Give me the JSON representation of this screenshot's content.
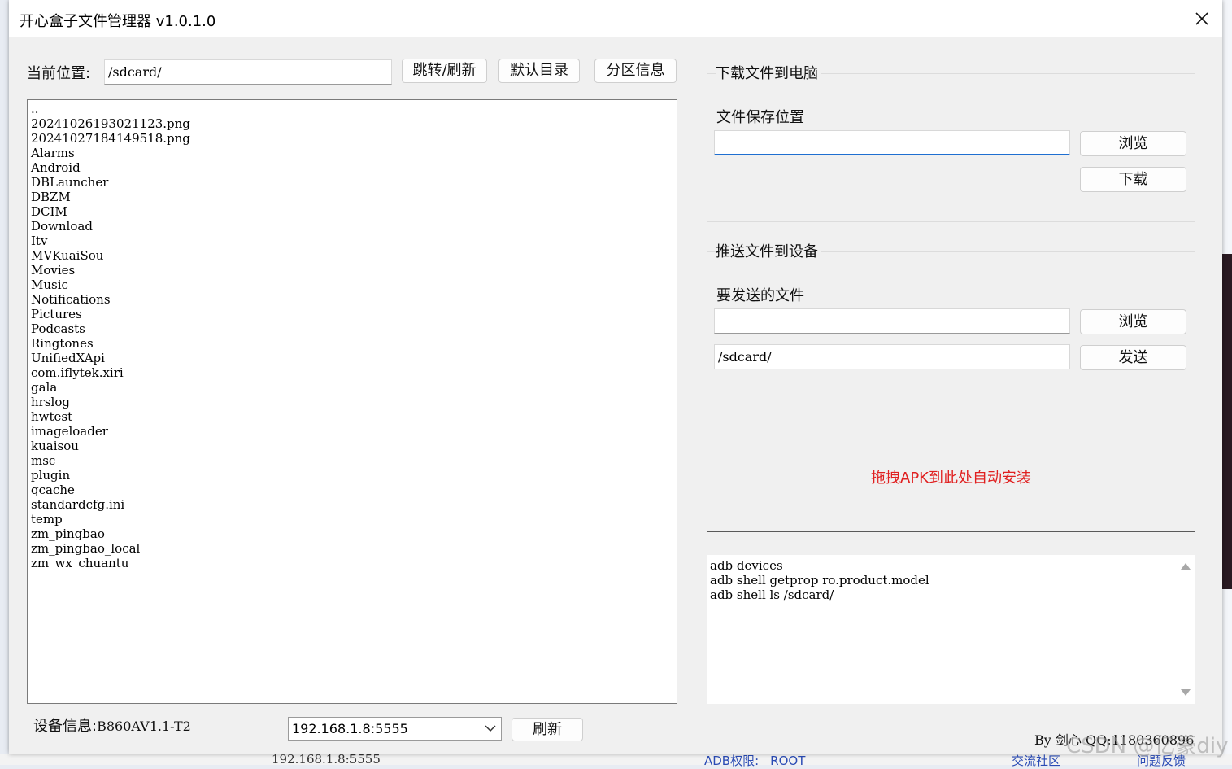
{
  "window": {
    "title": "开心盒子文件管理器 v1.0.1.0"
  },
  "location": {
    "label": "当前位置:",
    "value": "/sdcard/",
    "jump_refresh": "跳转/刷新",
    "default_dir": "默认目录",
    "partition_info": "分区信息"
  },
  "files": [
    "..",
    "20241026193021123.png",
    "20241027184149518.png",
    "Alarms",
    "Android",
    "DBLauncher",
    "DBZM",
    "DCIM",
    "Download",
    "Itv",
    "MVKuaiSou",
    "Movies",
    "Music",
    "Notifications",
    "Pictures",
    "Podcasts",
    "Ringtones",
    "UnifiedXApi",
    "com.iflytek.xiri",
    "gala",
    "hrslog",
    "hwtest",
    "imageloader",
    "kuaisou",
    "msc",
    "plugin",
    "qcache",
    "standardcfg.ini",
    "temp",
    "zm_pingbao",
    "zm_pingbao_local",
    "zm_wx_chuantu"
  ],
  "download": {
    "group_title": "下载文件到电脑",
    "save_label": "文件保存位置",
    "save_value": "",
    "browse": "浏览",
    "download": "下载"
  },
  "push": {
    "group_title": "推送文件到设备",
    "file_label": "要发送的文件",
    "file_value": "",
    "target_value": "/sdcard/",
    "browse": "浏览",
    "send": "发送"
  },
  "dropzone": {
    "text": "拖拽APK到此处自动安装",
    "text_color": "#e02020"
  },
  "log": [
    "adb devices",
    "adb shell getprop ro.product.model",
    "adb shell ls /sdcard/"
  ],
  "device": {
    "info_label": "设备信息:",
    "info_value": "B860AV1.1-T2",
    "address": "192.168.1.8:5555",
    "refresh": "刷新"
  },
  "footer": {
    "author": "By 剑心  QQ:1180360896",
    "watermark": "CSDN @亿豪diy"
  },
  "background": {
    "address": "192.168.1.8:5555",
    "adb_perm": "ADB权限:",
    "adb_perm_value": "ROOT",
    "community": "交流社区",
    "feedback": "问题反馈"
  }
}
